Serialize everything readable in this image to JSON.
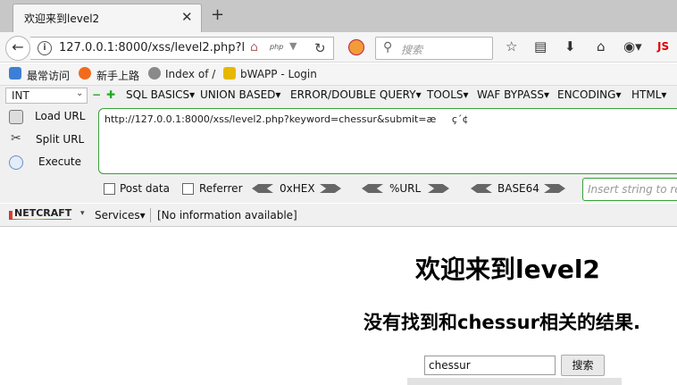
{
  "tab": {
    "title": "欢迎来到level2",
    "close": "✕",
    "new": "+"
  },
  "nav": {
    "url": "127.0.0.1:8000/xss/level2.php?l",
    "url_badge": "php",
    "search_placeholder": "搜索",
    "js_label": "JS"
  },
  "bookmarks": [
    {
      "label": "最常访问",
      "icon": "bookmark-icon"
    },
    {
      "label": "新手上路",
      "icon": "firefox-icon"
    },
    {
      "label": "Index of /",
      "icon": "globe-icon"
    },
    {
      "label": "bWAPP - Login",
      "icon": "bee-icon"
    }
  ],
  "hackbar": {
    "int_value": "INT",
    "menus": [
      "SQL BASICS▾",
      "UNION BASED▾",
      "ERROR/DOUBLE QUERY▾",
      "TOOLS▾",
      "WAF BYPASS▾",
      "ENCODING▾",
      "HTML▾"
    ],
    "load_url": "Load URL",
    "split_url": "Split URL",
    "execute": "Execute",
    "url_value": "http://127.0.0.1:8000/xss/level2.php?keyword=chessur&submit=æç´¢",
    "post_data": "Post data",
    "referrer": "Referrer",
    "hex": "0xHEX",
    "url_enc": "%URL",
    "base64": "BASE64",
    "insert_placeholder": "Insert string to re"
  },
  "netcraft": {
    "logo": "NETCRAFT",
    "services": "Services▾",
    "info": "[No information available]"
  },
  "page": {
    "heading": "欢迎来到level2",
    "result": "没有找到和chessur相关的结果.",
    "keyword_value": "chessur",
    "search_button": "搜索"
  },
  "colors": {
    "hackbar_border": "#3a9e3a",
    "tab_bg": "#f5f5f5",
    "chrome_bg": "#f0f0f0"
  }
}
